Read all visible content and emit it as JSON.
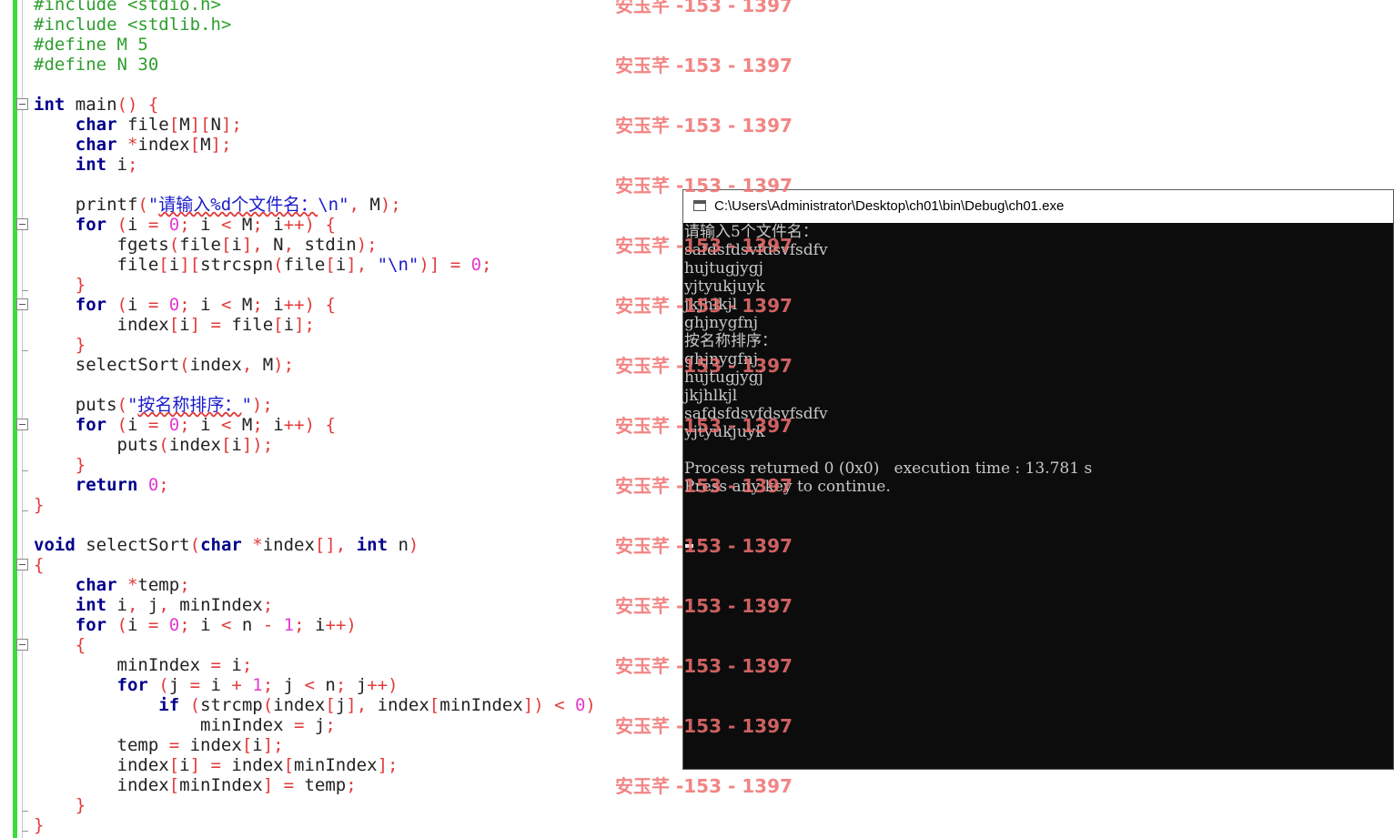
{
  "editor": {
    "lines": [
      [
        {
          "t": "#include <stdio.h>",
          "c": "pp"
        }
      ],
      [
        {
          "t": "#include <stdlib.h>",
          "c": "pp"
        }
      ],
      [
        {
          "t": "#define M 5",
          "c": "pp"
        }
      ],
      [
        {
          "t": "#define N 30",
          "c": "pp"
        }
      ],
      [],
      [
        {
          "t": "int",
          "c": "k"
        },
        {
          "t": " main",
          "c": "f"
        },
        {
          "t": "() {",
          "c": "p"
        }
      ],
      [
        {
          "t": "    "
        },
        {
          "t": "char",
          "c": "k"
        },
        {
          "t": " file",
          "c": "f"
        },
        {
          "t": "[",
          "c": "p"
        },
        {
          "t": "M",
          "c": "f"
        },
        {
          "t": "][",
          "c": "p"
        },
        {
          "t": "N",
          "c": "f"
        },
        {
          "t": "];",
          "c": "p"
        }
      ],
      [
        {
          "t": "    "
        },
        {
          "t": "char",
          "c": "k"
        },
        {
          "t": " *",
          "c": "p"
        },
        {
          "t": "index",
          "c": "f"
        },
        {
          "t": "[",
          "c": "p"
        },
        {
          "t": "M",
          "c": "f"
        },
        {
          "t": "];",
          "c": "p"
        }
      ],
      [
        {
          "t": "    "
        },
        {
          "t": "int",
          "c": "k"
        },
        {
          "t": " i",
          "c": "f"
        },
        {
          "t": ";",
          "c": "p"
        }
      ],
      [],
      [
        {
          "t": "    printf",
          "c": "f"
        },
        {
          "t": "(",
          "c": "p"
        },
        {
          "t": "\"",
          "c": "s"
        },
        {
          "t": "请输入%d个文件名：",
          "c": "s sq"
        },
        {
          "t": "\\n\"",
          "c": "s"
        },
        {
          "t": ", ",
          "c": "p"
        },
        {
          "t": "M",
          "c": "f"
        },
        {
          "t": ");",
          "c": "p"
        }
      ],
      [
        {
          "t": "    "
        },
        {
          "t": "for",
          "c": "k"
        },
        {
          "t": " (",
          "c": "p"
        },
        {
          "t": "i ",
          "c": "f"
        },
        {
          "t": "= ",
          "c": "p"
        },
        {
          "t": "0",
          "c": "n"
        },
        {
          "t": "; ",
          "c": "p"
        },
        {
          "t": "i ",
          "c": "f"
        },
        {
          "t": "< ",
          "c": "p"
        },
        {
          "t": "M",
          "c": "f"
        },
        {
          "t": "; ",
          "c": "p"
        },
        {
          "t": "i",
          "c": "f"
        },
        {
          "t": "++) {",
          "c": "p"
        }
      ],
      [
        {
          "t": "        fgets",
          "c": "f"
        },
        {
          "t": "(",
          "c": "p"
        },
        {
          "t": "file",
          "c": "f"
        },
        {
          "t": "[",
          "c": "p"
        },
        {
          "t": "i",
          "c": "f"
        },
        {
          "t": "], ",
          "c": "p"
        },
        {
          "t": "N",
          "c": "f"
        },
        {
          "t": ", ",
          "c": "p"
        },
        {
          "t": "stdin",
          "c": "f"
        },
        {
          "t": ");",
          "c": "p"
        }
      ],
      [
        {
          "t": "        file",
          "c": "f"
        },
        {
          "t": "[",
          "c": "p"
        },
        {
          "t": "i",
          "c": "f"
        },
        {
          "t": "][",
          "c": "p"
        },
        {
          "t": "strcspn",
          "c": "f"
        },
        {
          "t": "(",
          "c": "p"
        },
        {
          "t": "file",
          "c": "f"
        },
        {
          "t": "[",
          "c": "p"
        },
        {
          "t": "i",
          "c": "f"
        },
        {
          "t": "], ",
          "c": "p"
        },
        {
          "t": "\"\\n\"",
          "c": "s"
        },
        {
          "t": ")] = ",
          "c": "p"
        },
        {
          "t": "0",
          "c": "n"
        },
        {
          "t": ";",
          "c": "p"
        }
      ],
      [
        {
          "t": "    }",
          "c": "p"
        }
      ],
      [
        {
          "t": "    "
        },
        {
          "t": "for",
          "c": "k"
        },
        {
          "t": " (",
          "c": "p"
        },
        {
          "t": "i ",
          "c": "f"
        },
        {
          "t": "= ",
          "c": "p"
        },
        {
          "t": "0",
          "c": "n"
        },
        {
          "t": "; ",
          "c": "p"
        },
        {
          "t": "i ",
          "c": "f"
        },
        {
          "t": "< ",
          "c": "p"
        },
        {
          "t": "M",
          "c": "f"
        },
        {
          "t": "; ",
          "c": "p"
        },
        {
          "t": "i",
          "c": "f"
        },
        {
          "t": "++) {",
          "c": "p"
        }
      ],
      [
        {
          "t": "        index",
          "c": "f"
        },
        {
          "t": "[",
          "c": "p"
        },
        {
          "t": "i",
          "c": "f"
        },
        {
          "t": "] = ",
          "c": "p"
        },
        {
          "t": "file",
          "c": "f"
        },
        {
          "t": "[",
          "c": "p"
        },
        {
          "t": "i",
          "c": "f"
        },
        {
          "t": "];",
          "c": "p"
        }
      ],
      [
        {
          "t": "    }",
          "c": "p"
        }
      ],
      [
        {
          "t": "    selectSort",
          "c": "f"
        },
        {
          "t": "(",
          "c": "p"
        },
        {
          "t": "index",
          "c": "f"
        },
        {
          "t": ", ",
          "c": "p"
        },
        {
          "t": "M",
          "c": "f"
        },
        {
          "t": ");",
          "c": "p"
        }
      ],
      [],
      [
        {
          "t": "    puts",
          "c": "f"
        },
        {
          "t": "(",
          "c": "p"
        },
        {
          "t": "\"",
          "c": "s"
        },
        {
          "t": "按名称排序：",
          "c": "s sq"
        },
        {
          "t": "\"",
          "c": "s"
        },
        {
          "t": ");",
          "c": "p"
        }
      ],
      [
        {
          "t": "    "
        },
        {
          "t": "for",
          "c": "k"
        },
        {
          "t": " (",
          "c": "p"
        },
        {
          "t": "i ",
          "c": "f"
        },
        {
          "t": "= ",
          "c": "p"
        },
        {
          "t": "0",
          "c": "n"
        },
        {
          "t": "; ",
          "c": "p"
        },
        {
          "t": "i ",
          "c": "f"
        },
        {
          "t": "< ",
          "c": "p"
        },
        {
          "t": "M",
          "c": "f"
        },
        {
          "t": "; ",
          "c": "p"
        },
        {
          "t": "i",
          "c": "f"
        },
        {
          "t": "++) {",
          "c": "p"
        }
      ],
      [
        {
          "t": "        puts",
          "c": "f"
        },
        {
          "t": "(",
          "c": "p"
        },
        {
          "t": "index",
          "c": "f"
        },
        {
          "t": "[",
          "c": "p"
        },
        {
          "t": "i",
          "c": "f"
        },
        {
          "t": "]);",
          "c": "p"
        }
      ],
      [
        {
          "t": "    }",
          "c": "p"
        }
      ],
      [
        {
          "t": "    "
        },
        {
          "t": "return",
          "c": "k"
        },
        {
          "t": " 0",
          "c": "n"
        },
        {
          "t": ";",
          "c": "p"
        }
      ],
      [
        {
          "t": "}",
          "c": "p"
        }
      ],
      [],
      [
        {
          "t": "void",
          "c": "k"
        },
        {
          "t": " selectSort",
          "c": "f"
        },
        {
          "t": "(",
          "c": "p"
        },
        {
          "t": "char",
          "c": "k"
        },
        {
          "t": " *",
          "c": "p"
        },
        {
          "t": "index",
          "c": "f"
        },
        {
          "t": "[], ",
          "c": "p"
        },
        {
          "t": "int",
          "c": "k"
        },
        {
          "t": " n",
          "c": "f"
        },
        {
          "t": ")",
          "c": "p"
        }
      ],
      [
        {
          "t": "{",
          "c": "p"
        }
      ],
      [
        {
          "t": "    "
        },
        {
          "t": "char",
          "c": "k"
        },
        {
          "t": " *",
          "c": "p"
        },
        {
          "t": "temp",
          "c": "f"
        },
        {
          "t": ";",
          "c": "p"
        }
      ],
      [
        {
          "t": "    "
        },
        {
          "t": "int",
          "c": "k"
        },
        {
          "t": " i",
          "c": "f"
        },
        {
          "t": ", ",
          "c": "p"
        },
        {
          "t": "j",
          "c": "f"
        },
        {
          "t": ", ",
          "c": "p"
        },
        {
          "t": "minIndex",
          "c": "f"
        },
        {
          "t": ";",
          "c": "p"
        }
      ],
      [
        {
          "t": "    "
        },
        {
          "t": "for",
          "c": "k"
        },
        {
          "t": " (",
          "c": "p"
        },
        {
          "t": "i ",
          "c": "f"
        },
        {
          "t": "= ",
          "c": "p"
        },
        {
          "t": "0",
          "c": "n"
        },
        {
          "t": "; ",
          "c": "p"
        },
        {
          "t": "i ",
          "c": "f"
        },
        {
          "t": "< ",
          "c": "p"
        },
        {
          "t": "n ",
          "c": "f"
        },
        {
          "t": "- ",
          "c": "p"
        },
        {
          "t": "1",
          "c": "n"
        },
        {
          "t": "; ",
          "c": "p"
        },
        {
          "t": "i",
          "c": "f"
        },
        {
          "t": "++)",
          "c": "p"
        }
      ],
      [
        {
          "t": "    {",
          "c": "p"
        }
      ],
      [
        {
          "t": "        minIndex ",
          "c": "f"
        },
        {
          "t": "= ",
          "c": "p"
        },
        {
          "t": "i",
          "c": "f"
        },
        {
          "t": ";",
          "c": "p"
        }
      ],
      [
        {
          "t": "        "
        },
        {
          "t": "for",
          "c": "k"
        },
        {
          "t": " (",
          "c": "p"
        },
        {
          "t": "j ",
          "c": "f"
        },
        {
          "t": "= ",
          "c": "p"
        },
        {
          "t": "i ",
          "c": "f"
        },
        {
          "t": "+ ",
          "c": "p"
        },
        {
          "t": "1",
          "c": "n"
        },
        {
          "t": "; ",
          "c": "p"
        },
        {
          "t": "j ",
          "c": "f"
        },
        {
          "t": "< ",
          "c": "p"
        },
        {
          "t": "n",
          "c": "f"
        },
        {
          "t": "; ",
          "c": "p"
        },
        {
          "t": "j",
          "c": "f"
        },
        {
          "t": "++)",
          "c": "p"
        }
      ],
      [
        {
          "t": "            "
        },
        {
          "t": "if",
          "c": "k"
        },
        {
          "t": " (",
          "c": "p"
        },
        {
          "t": "strcmp",
          "c": "f"
        },
        {
          "t": "(",
          "c": "p"
        },
        {
          "t": "index",
          "c": "f"
        },
        {
          "t": "[",
          "c": "p"
        },
        {
          "t": "j",
          "c": "f"
        },
        {
          "t": "], ",
          "c": "p"
        },
        {
          "t": "index",
          "c": "f"
        },
        {
          "t": "[",
          "c": "p"
        },
        {
          "t": "minIndex",
          "c": "f"
        },
        {
          "t": "]) < ",
          "c": "p"
        },
        {
          "t": "0",
          "c": "n"
        },
        {
          "t": ")",
          "c": "p"
        }
      ],
      [
        {
          "t": "                minIndex ",
          "c": "f"
        },
        {
          "t": "= ",
          "c": "p"
        },
        {
          "t": "j",
          "c": "f"
        },
        {
          "t": ";",
          "c": "p"
        }
      ],
      [
        {
          "t": "        temp ",
          "c": "f"
        },
        {
          "t": "= ",
          "c": "p"
        },
        {
          "t": "index",
          "c": "f"
        },
        {
          "t": "[",
          "c": "p"
        },
        {
          "t": "i",
          "c": "f"
        },
        {
          "t": "];",
          "c": "p"
        }
      ],
      [
        {
          "t": "        index",
          "c": "f"
        },
        {
          "t": "[",
          "c": "p"
        },
        {
          "t": "i",
          "c": "f"
        },
        {
          "t": "] = ",
          "c": "p"
        },
        {
          "t": "index",
          "c": "f"
        },
        {
          "t": "[",
          "c": "p"
        },
        {
          "t": "minIndex",
          "c": "f"
        },
        {
          "t": "];",
          "c": "p"
        }
      ],
      [
        {
          "t": "        index",
          "c": "f"
        },
        {
          "t": "[",
          "c": "p"
        },
        {
          "t": "minIndex",
          "c": "f"
        },
        {
          "t": "] = ",
          "c": "p"
        },
        {
          "t": "temp",
          "c": "f"
        },
        {
          "t": ";",
          "c": "p"
        }
      ],
      [
        {
          "t": "    }",
          "c": "p"
        }
      ],
      [
        {
          "t": "}",
          "c": "p"
        }
      ]
    ],
    "fold_markers": [
      5,
      11,
      15,
      21,
      28,
      32
    ],
    "fold_ends": [
      14,
      17,
      23,
      25,
      40,
      41
    ]
  },
  "watermark": {
    "text": "安玉芊 -153 - 1397",
    "color": "#f07070"
  },
  "console": {
    "title": "C:\\Users\\Administrator\\Desktop\\ch01\\bin\\Debug\\ch01.exe",
    "lines": [
      "请输入5个文件名：",
      "safdsfdsvfdsvfsdfv",
      "hujtugjygj",
      "yjtyukjuyk",
      "jkjhlkjl",
      "ghjnygfnj",
      "按名称排序：",
      "ghjnygfnj",
      "hujtugjygj",
      "jkjhlkjl",
      "safdsfdsvfdsvfsdfv",
      "yjtyukjuyk",
      "",
      "Process returned 0 (0x0)   execution time : 13.781 s",
      "Press any key to continue."
    ]
  }
}
